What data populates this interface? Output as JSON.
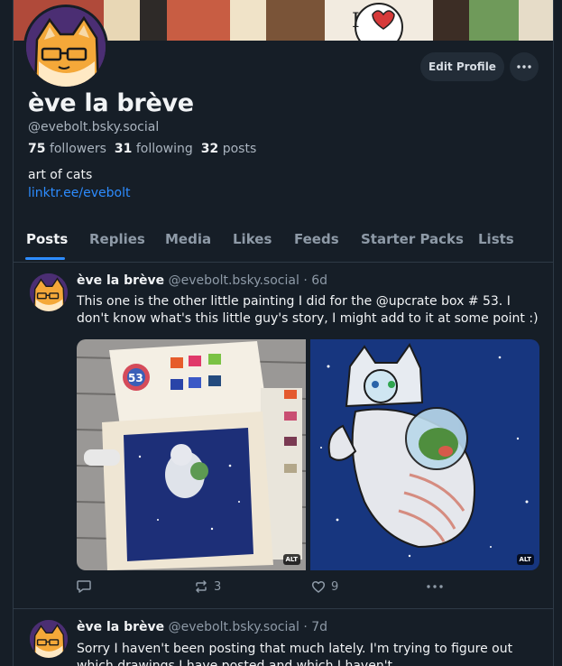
{
  "profile": {
    "display_name": "ève la brève",
    "handle": "@evebolt.bsky.social",
    "followers_count": "75",
    "followers_label": "followers",
    "following_count": "31",
    "following_label": "following",
    "posts_count": "32",
    "posts_label": "posts",
    "bio": "art of cats",
    "link": "linktr.ee/evebolt",
    "edit_profile_label": "Edit Profile"
  },
  "tabs": [
    {
      "label": "Posts",
      "active": true
    },
    {
      "label": "Replies"
    },
    {
      "label": "Media"
    },
    {
      "label": "Likes"
    },
    {
      "label": "Feeds"
    },
    {
      "label": "Starter Packs"
    },
    {
      "label": "Lists"
    }
  ],
  "posts": [
    {
      "author": "ève la brève",
      "handle": "@evebolt.bsky.social",
      "time": "· 6d",
      "text": "This one is the other little painting I did for the @upcrate box # 53. I don't know what's this little guy's story, I might add to it at some point :)",
      "image_alt_labels": [
        "ALT",
        "ALT"
      ],
      "replies": "",
      "reposts": "3",
      "likes": "9"
    },
    {
      "author": "ève la brève",
      "handle": "@evebolt.bsky.social",
      "time": "· 7d",
      "text": "Sorry I haven't been posting that much lately. I'm trying to figure out which drawings I have posted and which I haven't..."
    }
  ],
  "icons": {
    "more": "ellipsis-icon",
    "reply": "speech-bubble-icon",
    "repost": "repost-arrows-icon",
    "like": "heart-icon"
  },
  "colors": {
    "background": "#161e27",
    "accent": "#2d8cff",
    "muted_text": "#8e9aa7"
  }
}
